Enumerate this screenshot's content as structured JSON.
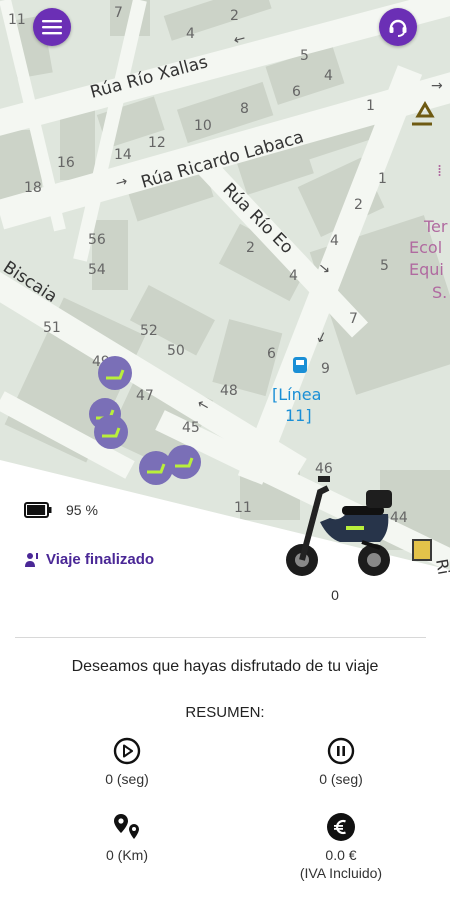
{
  "map": {
    "streets": [
      "Rúa Río Xallas",
      "Rúa Ricardo Labaca",
      "Rúa Río Eo",
      "Biscaia"
    ],
    "numbers": [
      "11",
      "7",
      "2",
      "4",
      "5",
      "6",
      "4",
      "8",
      "10",
      "1",
      "12",
      "14",
      "16",
      "18",
      "2",
      "1",
      "56",
      "54",
      "2",
      "4",
      "4",
      "5",
      "51",
      "52",
      "50",
      "6",
      "7",
      "9",
      "49",
      "47",
      "48",
      "45",
      "46",
      "11",
      "44"
    ],
    "bus_stop": {
      "line_name": "[Línea",
      "line_num": "11]"
    },
    "poi": {
      "l1": "Ter",
      "l2": "Ecol",
      "l3": "Equi",
      "l4": "S."
    },
    "edge_text": "Ri"
  },
  "header": {
    "menu_icon": "hamburger-menu-icon",
    "support_icon": "headset-support-icon"
  },
  "vehicle": {
    "battery_icon": "battery-icon",
    "battery_level": "95 %",
    "battery_fraction": 0.95,
    "trip_icon": "person-pin-icon",
    "trip_status": "Viaje finalizado",
    "scooter_image": "electric-scooter",
    "scooter_value": "0"
  },
  "summary": {
    "thanks": "Deseamos que hayas disfrutado de tu viaje",
    "title": "RESUMEN:",
    "riding_time": "0 (seg)",
    "paused_time": "0 (seg)",
    "distance": "0 (Km)",
    "price": "0.0 €",
    "price_note": "(IVA Incluido)"
  },
  "colors": {
    "primary": "#6b2fb5",
    "trip_text": "#4a2796",
    "map_bg": "#dfe6dd",
    "road": "#f4f7f2",
    "building": "#cfd4cb"
  }
}
